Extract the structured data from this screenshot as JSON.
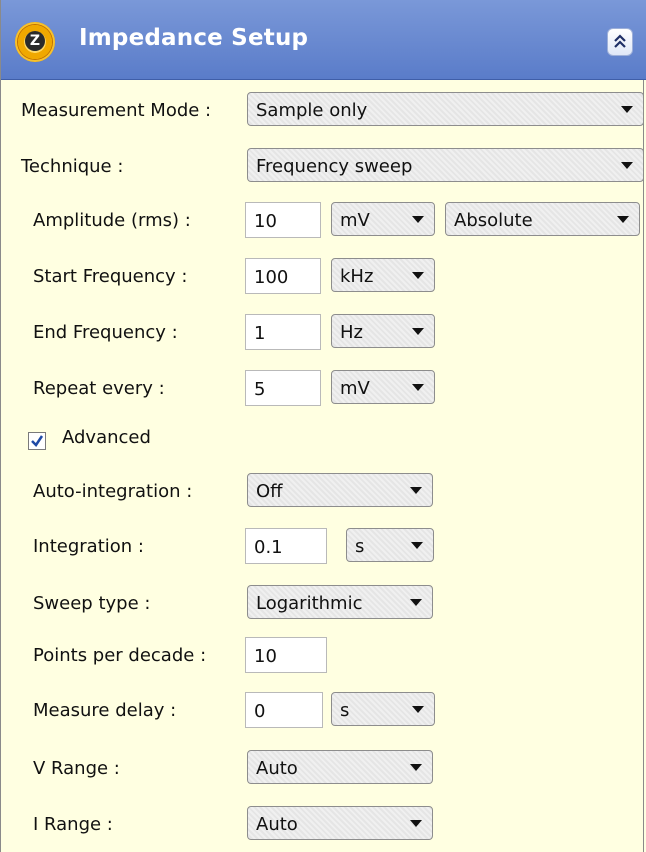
{
  "header": {
    "title": "Impedance Setup",
    "app_icon_letter": "Z"
  },
  "fields": {
    "measurement_mode": {
      "label": "Measurement Mode :",
      "value": "Sample only"
    },
    "technique": {
      "label": "Technique :",
      "value": "Frequency sweep"
    },
    "amplitude": {
      "label": "Amplitude (rms) :",
      "value": "10",
      "unit": "mV",
      "mode": "Absolute"
    },
    "start_frequency": {
      "label": "Start Frequency :",
      "value": "100",
      "unit": "kHz"
    },
    "end_frequency": {
      "label": "End Frequency :",
      "value": "1",
      "unit": "Hz"
    },
    "repeat_every": {
      "label": "Repeat every :",
      "value": "5",
      "unit": "mV"
    },
    "advanced": {
      "label": "Advanced",
      "checked": true
    },
    "auto_integration": {
      "label": "Auto-integration :",
      "value": "Off"
    },
    "integration": {
      "label": "Integration :",
      "value": "0.1",
      "unit": "s"
    },
    "sweep_type": {
      "label": "Sweep type :",
      "value": "Logarithmic"
    },
    "points_per_decade": {
      "label": "Points per decade :",
      "value": "10"
    },
    "measure_delay": {
      "label": "Measure delay :",
      "value": "0",
      "unit": "s"
    },
    "v_range": {
      "label": "V Range :",
      "value": "Auto"
    },
    "i_range": {
      "label": "I Range :",
      "value": "Auto"
    }
  },
  "icons": {
    "app": "gear-z-icon",
    "collapse": "double-chevron-up-icon",
    "dropdown": "triangle-down-icon",
    "check": "checkmark-icon"
  },
  "colors": {
    "header": "#5a7cc9",
    "panel_background": "#ffffe1",
    "check": "#1f4aa6"
  }
}
